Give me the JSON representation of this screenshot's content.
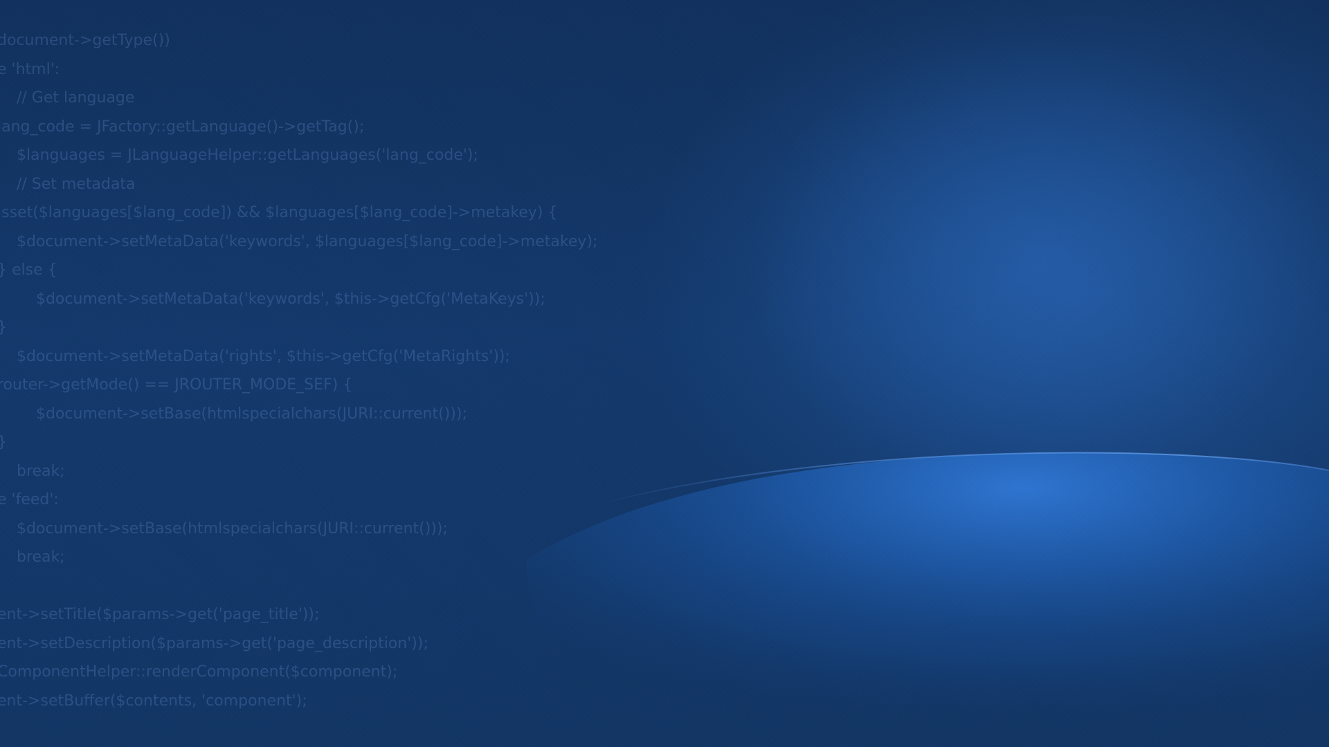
{
  "wallpaper": {
    "colors": {
      "background_dark": "#0f2f5c",
      "background_mid": "#12386c",
      "glow_light": "#2f78d8",
      "code_text": "#5d87c4"
    },
    "code_lines": [
      "document->getType())",
      "e 'html':",
      "    // Get language",
      "lang_code = JFactory::getLanguage()->getTag();",
      "    $languages = JLanguageHelper::getLanguages('lang_code');",
      "    // Set metadata",
      "isset($languages[$lang_code]) && $languages[$lang_code]->metakey) {",
      "    $document->setMetaData('keywords', $languages[$lang_code]->metakey);",
      "} else {",
      "        $document->setMetaData('keywords', $this->getCfg('MetaKeys'));",
      "}",
      "    $document->setMetaData('rights', $this->getCfg('MetaRights'));",
      "router->getMode() == JROUTER_MODE_SEF) {",
      "        $document->setBase(htmlspecialchars(JURI::current()));",
      "}",
      "    break;",
      "e 'feed':",
      "    $document->setBase(htmlspecialchars(JURI::current()));",
      "    break;",
      "",
      "ent->setTitle($params->get('page_title'));",
      "ent->setDescription($params->get('page_description'));",
      "ComponentHelper::renderComponent($component);",
      "ent->setBuffer($contents, 'component');"
    ]
  }
}
